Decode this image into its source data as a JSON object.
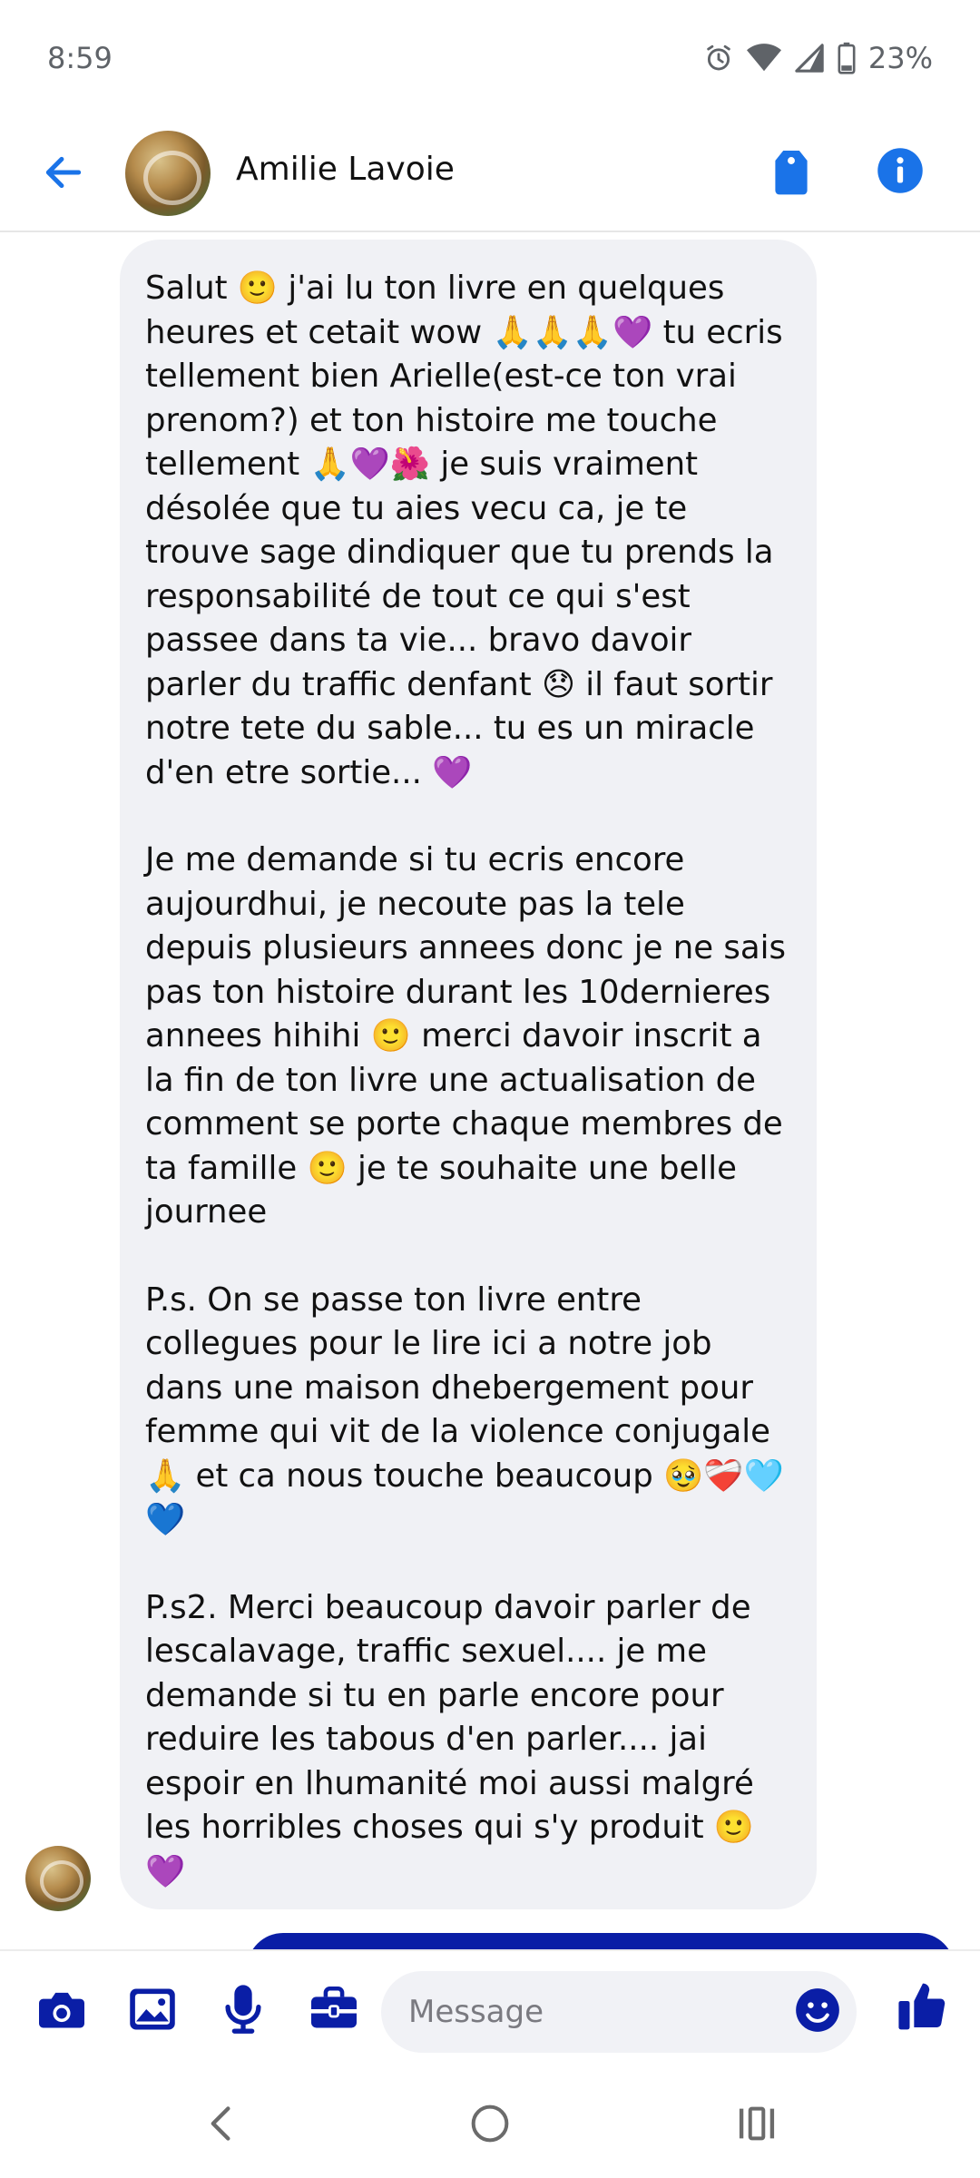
{
  "status_bar": {
    "time": "8:59",
    "battery": "23%"
  },
  "header": {
    "contact_name": "Amilie Lavoie"
  },
  "message": {
    "paragraphs": [
      "Salut 🙂 j'ai lu ton livre en quelques heures et cetait wow 🙏🙏🙏💜 tu ecris tellement bien Arielle(est-ce ton vrai prenom?) et ton histoire me touche tellement 🙏💜🌺 je suis vraiment désolée que tu aies vecu ca, je te trouve sage dindiquer que tu prends la responsabilité de tout ce qui s'est passee dans ta vie... bravo davoir parler du traffic denfant 😞 il faut sortir notre tete du sable... tu es un miracle d'en etre sortie... 💜",
      "Je me demande si tu ecris encore aujourdhui, je necoute pas la tele depuis plusieurs annees donc je ne sais pas ton histoire durant les 10dernieres annees hihihi 🙂 merci davoir inscrit a la fin de ton livre une actualisation de comment se porte chaque membres de ta famille 🙂 je te souhaite une belle journee",
      "P.s. On se passe ton livre entre collegues pour le lire ici a notre job dans une maison dhebergement pour femme qui vit de la violence conjugale 🙏 et ca nous touche beaucoup 🥹❤️‍🩹🩵💙",
      "P.s2. Merci beaucoup davoir parler de lescalavage, traffic sexuel.... je me demande si tu en parle encore pour reduire les tabous d'en parler.... jai espoir en lhumanité moi aussi malgré les horribles choses qui s'y produit 🙂💜"
    ]
  },
  "composer": {
    "placeholder": "Message"
  },
  "icons": {
    "status": [
      "alarm-icon",
      "wifi-icon",
      "signal-icon",
      "battery-icon"
    ],
    "header": [
      "back-arrow-icon",
      "tag-icon",
      "info-icon"
    ],
    "composer": [
      "camera-icon",
      "image-icon",
      "microphone-icon",
      "briefcase-icon",
      "emoji-icon",
      "thumbs-up-icon"
    ],
    "nav": [
      "nav-back-icon",
      "nav-home-icon",
      "nav-recents-icon"
    ]
  },
  "colors": {
    "accent": "#1a73e8",
    "composer_icons": "#0a1ea6",
    "bubble_bg": "#f0f1f5",
    "outgoing_bubble": "#0a1ea6"
  }
}
